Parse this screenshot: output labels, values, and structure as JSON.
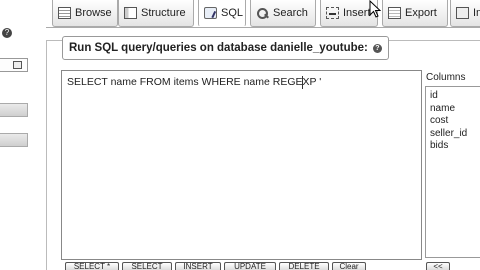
{
  "tabs": [
    {
      "label": "Browse",
      "icon": "browse-icon"
    },
    {
      "label": "Structure",
      "icon": "structure-icon"
    },
    {
      "label": "SQL",
      "icon": "sql-icon",
      "active": true
    },
    {
      "label": "Search",
      "icon": "search-icon"
    },
    {
      "label": "Insert",
      "icon": "insert-icon"
    },
    {
      "label": "Export",
      "icon": "export-icon"
    },
    {
      "label": "Im",
      "icon": "import-icon"
    }
  ],
  "query": {
    "legend": "Run SQL query/queries on database danielle_youtube:",
    "text": "SELECT name FROM items WHERE name REGEXP '"
  },
  "columns": {
    "label": "Columns",
    "items": [
      "id",
      "name",
      "cost",
      "seller_id",
      "bids"
    ]
  },
  "buttons": {
    "select_star": "SELECT *",
    "select": "SELECT",
    "insert": "INSERT",
    "update": "UPDATE",
    "delete": "DELETE",
    "clear": "Clear",
    "insert_col": "<<"
  },
  "colors": {
    "border": "#aaaaaa",
    "tab_gradient_bottom": "#e4e4e4",
    "text": "#222222"
  }
}
